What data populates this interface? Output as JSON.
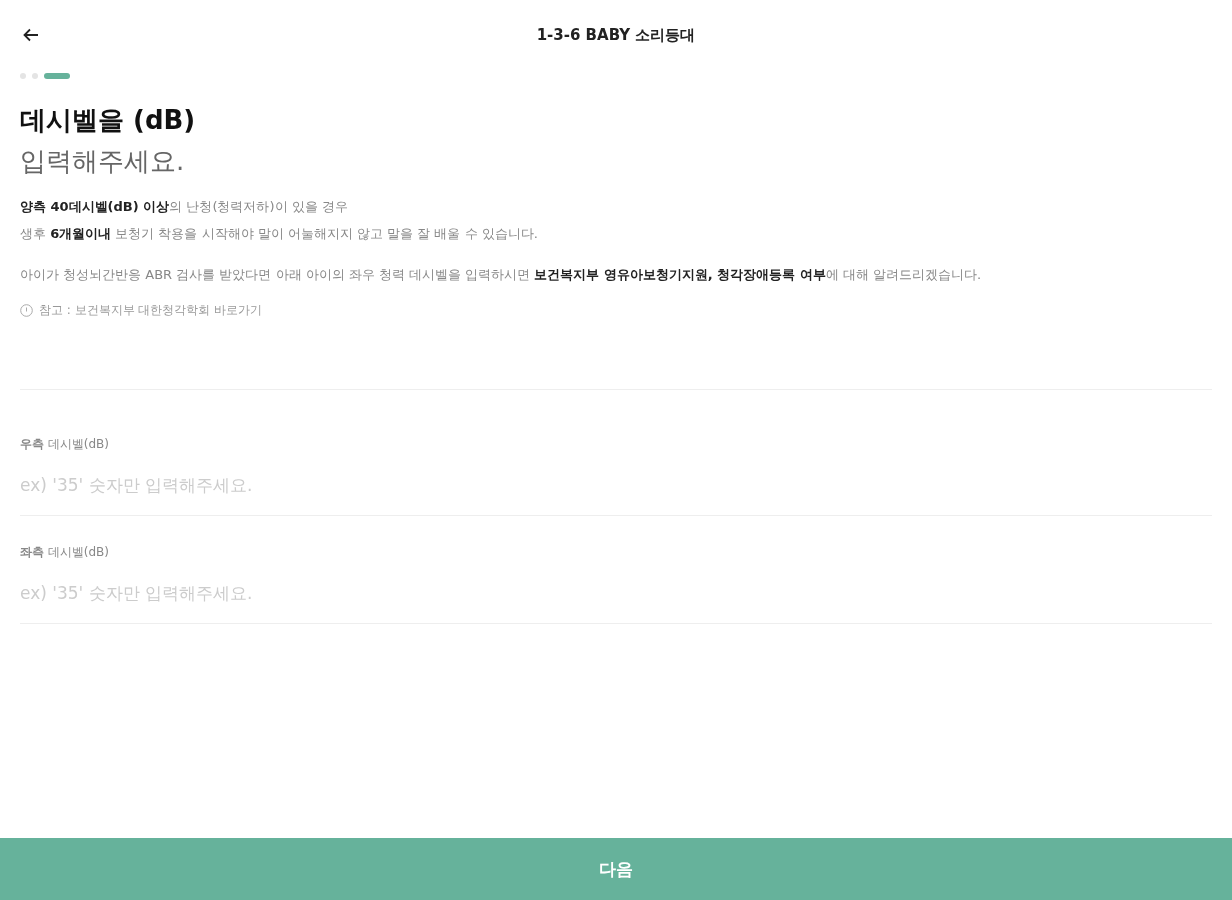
{
  "header": {
    "title": "1-3-6 BABY 소리등대"
  },
  "steps": [
    {
      "active": false
    },
    {
      "active": false
    },
    {
      "active": true
    }
  ],
  "heading": {
    "title": "데시벨을 (dB)",
    "subtitle": "입력해주세요."
  },
  "paragraphs": [
    "**양측 40데시벨(dB) 이상**의 난청(청력저하)이 있을 경우\n생후 **6개월이내** 보청기 착용을 시작해야 말이 어눌해지지 않고 말을 잘 배울 수 있습니다.",
    "아이가 청성뇌간반응 ABR 검사를 받았다면 아래 아이의 좌우 청력 데시벨을 입력하시면 **보건복지부 영유아보청기지원, 청각장애등록 여부**에 대해 알려드리겠습니다."
  ],
  "note": "참고 : 보건복지부 대한청각학회 바로가기",
  "fields": [
    {
      "label": "**우측** 데시벨(dB)",
      "placeholder": "ex) '35' 숫자만 입력해주세요."
    },
    {
      "label": "**좌측** 데시벨(dB)",
      "placeholder": "ex) '35' 숫자만 입력해주세요."
    }
  ],
  "next_button": "다음"
}
